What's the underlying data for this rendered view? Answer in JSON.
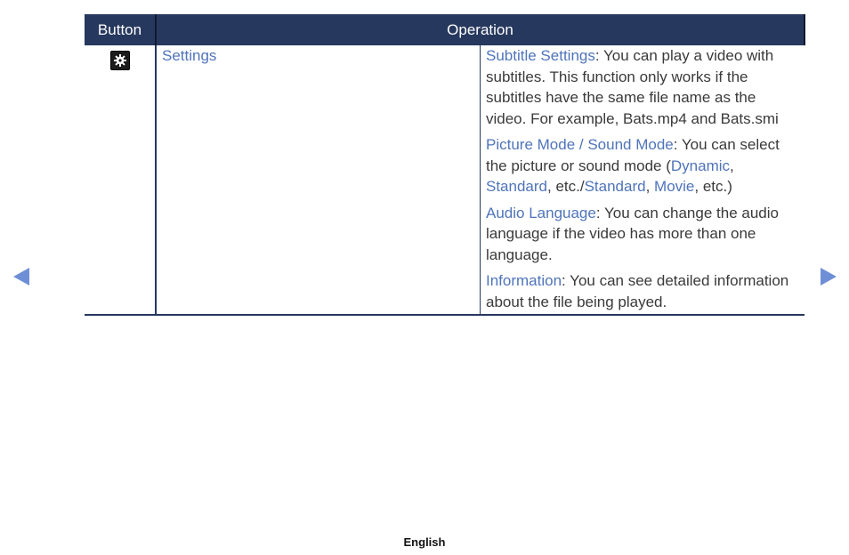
{
  "table": {
    "headers": {
      "button": "Button",
      "operation": "Operation"
    },
    "row": {
      "icon": "settings-gear-icon",
      "name": "Settings",
      "items": [
        {
          "title": "Subtitle Settings",
          "text": ": You can play a video with subtitles. This function only works if the subtitles have the same file name as the video. For example, Bats.mp4 and Bats.smi"
        },
        {
          "title": "Picture Mode / Sound Mode",
          "text_a": ": You can select the picture or sound mode (",
          "opt1": "Dynamic",
          "sep1": ", ",
          "opt2": "Standard",
          "sep2": ", etc./",
          "opt3": "Standard",
          "sep3": ", ",
          "opt4": "Movie",
          "text_b": ", etc.)"
        },
        {
          "title": "Audio Language",
          "text": ": You can change the audio language if the video has more than one language."
        },
        {
          "title": "Information",
          "text": ": You can see detailed information about the file being played."
        }
      ]
    }
  },
  "nav": {
    "prev": "triangle-left-icon",
    "next": "triangle-right-icon"
  },
  "footer": {
    "language": "English"
  },
  "colors": {
    "header_bg": "#27385e",
    "link": "#4f74bb",
    "arrow": "#6e8fd6"
  }
}
